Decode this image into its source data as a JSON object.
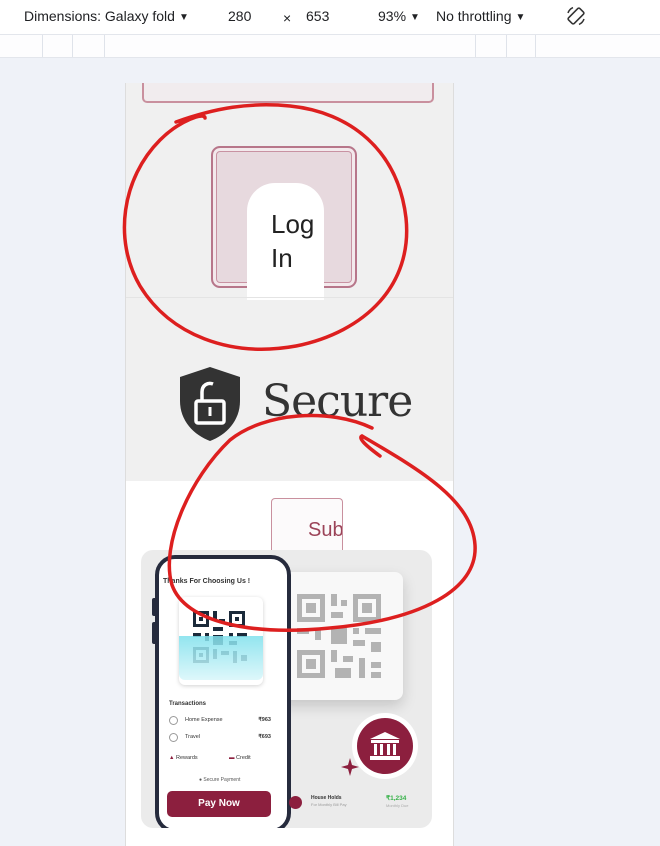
{
  "devtools": {
    "dimensions_label": "Dimensions: Galaxy fold",
    "width_value": "280",
    "times_symbol": "×",
    "height_value": "653",
    "zoom": "93%",
    "throttling": "No throttling",
    "rotate_icon": "rotate-device-icon"
  },
  "page": {
    "login_label": "Log In",
    "secure_label": "Secure",
    "submit_label": "Sub",
    "phone": {
      "title": "Thanks For Choosing Us !",
      "transactions_heading": "Transactions",
      "rows": [
        {
          "name": "Home Expense",
          "amount": "₹963"
        },
        {
          "name": "Travel",
          "amount": "₹693"
        }
      ],
      "rewards_label": "Rewards",
      "credit_label": "Credit",
      "secure_payment": "Secure Payment",
      "pay_button": "Pay Now"
    },
    "household": {
      "label": "House Holds",
      "sub": "For Monthly Bill Pay",
      "amount": "₹1,234",
      "note": "Monthly Due"
    }
  },
  "colors": {
    "accent": "#8c1f3e",
    "annotation": "#dd1f1f",
    "positive": "#38b24a"
  }
}
